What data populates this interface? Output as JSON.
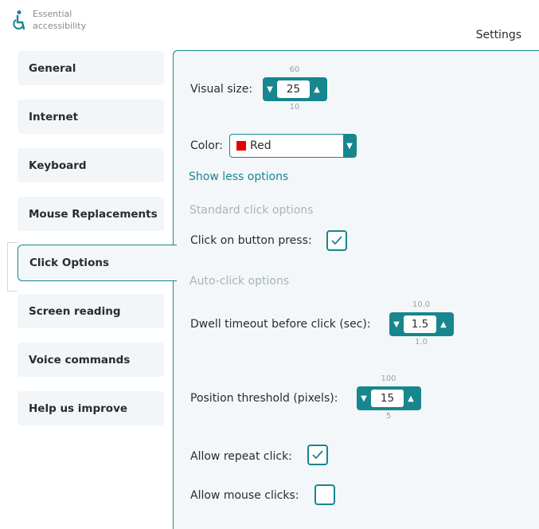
{
  "app": {
    "name": "Essential accessibility",
    "title": "Settings"
  },
  "sidebar": {
    "items": [
      {
        "label": "General"
      },
      {
        "label": "Internet"
      },
      {
        "label": "Keyboard"
      },
      {
        "label": "Mouse Replacements"
      },
      {
        "label": "Click Options",
        "active": true
      },
      {
        "label": "Screen reading"
      },
      {
        "label": "Voice commands"
      },
      {
        "label": "Help us improve"
      }
    ]
  },
  "settings": {
    "visual_size": {
      "label": "Visual size:",
      "value": "25",
      "max": "60",
      "min": "10"
    },
    "color": {
      "label": "Color:",
      "value": "Red",
      "swatch": "#e60000"
    },
    "show_less": "Show less options",
    "standard_header": "Standard click options",
    "click_on_button_press": {
      "label": "Click on button press:",
      "checked": true
    },
    "auto_header": "Auto-click options",
    "dwell_timeout": {
      "label": "Dwell timeout before click (sec):",
      "value": "1.5",
      "max": "10.0",
      "min": "1.0"
    },
    "position_threshold": {
      "label": "Position threshold (pixels):",
      "value": "15",
      "max": "100",
      "min": "5"
    },
    "allow_repeat_click": {
      "label": "Allow repeat click:",
      "checked": true
    },
    "allow_mouse_clicks": {
      "label": "Allow mouse clicks:",
      "checked": false
    }
  },
  "colors": {
    "accent": "#17868d"
  }
}
